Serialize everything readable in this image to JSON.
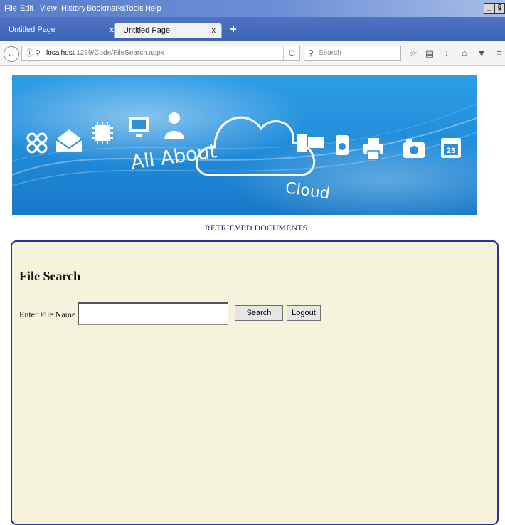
{
  "browser": {
    "menu": [
      "File",
      "Edit",
      "View",
      "History",
      "Bookmarks",
      "Tools",
      "Help"
    ],
    "window_controls": [
      "_",
      "§"
    ],
    "tabs": [
      {
        "label": "Untitled Page",
        "active": false,
        "close": "x"
      },
      {
        "label": "Untitled Page",
        "active": true,
        "close": "x"
      }
    ],
    "new_tab": "+",
    "back": "←",
    "url_host": "localhost",
    "url_rest": ":1289/Code/FileSearch.aspx",
    "reload": "C",
    "search_placeholder": "Search",
    "icons": [
      "star-icon",
      "reading-list-icon",
      "download-icon",
      "home-icon",
      "pocket-icon",
      "menu-icon"
    ]
  },
  "banner": {
    "text1": "All About",
    "text2": "Cloud",
    "calendar_day": "23"
  },
  "page": {
    "link": "RETRIEVED DOCUMENTS",
    "title": "File Search",
    "field_label": "Enter File Name :",
    "file_value": "",
    "search_button": "Search",
    "logout_button": "Logout"
  },
  "colors": {
    "panel_bg": "#f5f3dc",
    "panel_border": "#2b2fa8",
    "link": "#1b2a8a",
    "banner": "#1f89d8"
  }
}
